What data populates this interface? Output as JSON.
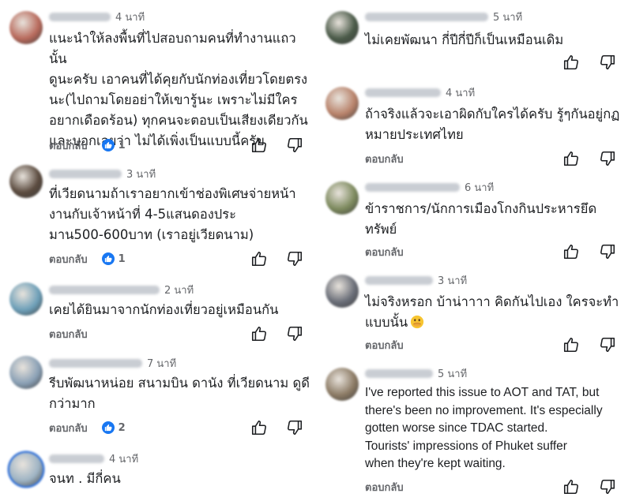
{
  "left_column": [
    {
      "avatar_color": "#b86a5c",
      "time": "4 นาที",
      "lines": [
        "แนะนำให้ลงพื้นที่ไปสอบถามคนที่ทำงานแถวนั้น",
        "ดูนะครับ เอาคนที่ได้คุยกับนักท่องเที่ยวโดยตรง",
        "นะ(ไปถามโดยอย่าให้เขารู้นะ เพราะไม่มีใคร",
        "อยากเดือดร้อน) ทุกคนจะตอบเป็นเสียงเดียวกัน",
        "และบอกเลยว่า ไม่ได้เพิ่งเป็นแบบนี้ครับ"
      ],
      "reply_label": "ตอบกลับ",
      "reaction_count": "1"
    },
    {
      "avatar_color": "#5a4a3e",
      "time": "3 นาที",
      "lines": [
        "ที่เวียดนามถ้าเราอยากเข้าช่องพิเศษจ่ายหน้า",
        "งานกับเจ้าหน้าที่ 4-5แสนดองประ",
        "มาน500-600บาท (เราอยู่เวียดนาม)"
      ],
      "reply_label": "ตอบกลับ",
      "reaction_count": "1"
    },
    {
      "avatar_color": "#6d9fb8",
      "time": "2 นาที",
      "lines": [
        "เคยได้ยินมาจากนักท่องเที่ยวอยู่เหมือนกัน"
      ],
      "reply_label": "ตอบกลับ",
      "reaction_count": ""
    },
    {
      "avatar_color": "#8aa0b5",
      "time": "7 นาที",
      "lines": [
        "รีบพัฒนาหน่อย สนามบิน ดานัง ที่เวียดนาม ดูดี",
        "กว่ามาก"
      ],
      "reply_label": "ตอบกลับ",
      "reaction_count": "2"
    },
    {
      "avatar_color": "#9fb4c4",
      "time": "4 นาที",
      "lines": [
        "จนท . มีกี่คน"
      ],
      "reply_label": "",
      "reaction_count": ""
    }
  ],
  "right_column": [
    {
      "avatar_color": "#4a5a48",
      "time": "5 นาที",
      "lines": [
        "ไม่เคยพัฒนา กี่ปีกี่ปีก็เป็นเหมือนเดิม"
      ],
      "reply_label": "",
      "reaction_count": ""
    },
    {
      "avatar_color": "#b8826a",
      "time": "4 นาที",
      "lines": [
        "ถ้าจริงแล้วจะเอาผิดกับใครได้ครับ รู้ๆกันอยู่กฏ",
        "หมายประเทศไทย"
      ],
      "reply_label": "ตอบกลับ",
      "reaction_count": ""
    },
    {
      "avatar_color": "#7d8a5e",
      "time": "6 นาที",
      "lines": [
        "ข้าราชการ/นักการเมืองโกงกินประหารยึด",
        "ทรัพย์"
      ],
      "reply_label": "ตอบกลับ",
      "reaction_count": ""
    },
    {
      "avatar_color": "#6a6e78",
      "time": "3 นาที",
      "lines": [
        "ไม่จริงหรอก บ้าน่าาาา คิดกันไปเอง ใครจะทำ",
        "แบบนั้น"
      ],
      "emoji": "face-with-hand-over-mouth-icon",
      "reply_label": "ตอบกลับ",
      "reaction_count": ""
    },
    {
      "avatar_color": "#8b7a64",
      "time": "5 นาที",
      "lines": [
        "I've reported this issue to AOT and TAT, but",
        "there's been no improvement. It's especially",
        "gotten worse since TDAC started.",
        "Tourists' impressions of Phuket suffer",
        "when they're kept waiting."
      ],
      "reply_label": "ตอบกลับ",
      "reaction_count": ""
    }
  ],
  "colors": {
    "like_blue": "#1877f2",
    "meta_gray": "#65676b",
    "text": "#1c1e21"
  },
  "icons": [
    "thumbs-up-icon",
    "thumbs-down-icon",
    "like-reaction-icon"
  ]
}
